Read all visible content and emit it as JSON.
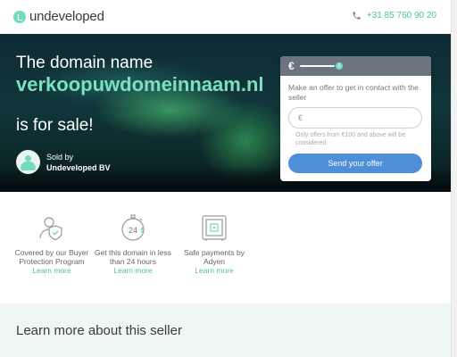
{
  "header": {
    "logo_text": "undeveloped",
    "phone": "+31 85 760 90 20"
  },
  "hero": {
    "title_line1": "The domain name",
    "domain": "verkoopuwdomeinnaam.nl",
    "title_line3": "is for sale!",
    "sold_by_label": "Sold by",
    "seller_name": "Undeveloped BV"
  },
  "offer_card": {
    "currency_symbol": "€",
    "step": "2",
    "intro": "Make an offer to get in contact with the seller",
    "input_placeholder": "€",
    "hint": "Only offers from €100 and above will be considered",
    "button_label": "Send your offer"
  },
  "features": [
    {
      "label": "Covered by our Buyer Protection Program",
      "link": "Learn more"
    },
    {
      "label": "Get this domain in less than 24 hours",
      "link": "Learn more"
    },
    {
      "label": "Safe payments by Adyen",
      "link": "Learn more"
    }
  ],
  "seller_section": {
    "title": "Learn more about this seller"
  },
  "colors": {
    "accent": "#74dbbe",
    "button": "#4d8fd9",
    "card_header": "#6c7480"
  },
  "icons": {
    "phone": "phone-icon",
    "protection": "shield-person-icon",
    "timer": "stopwatch-24-icon",
    "payment": "safe-icon"
  }
}
